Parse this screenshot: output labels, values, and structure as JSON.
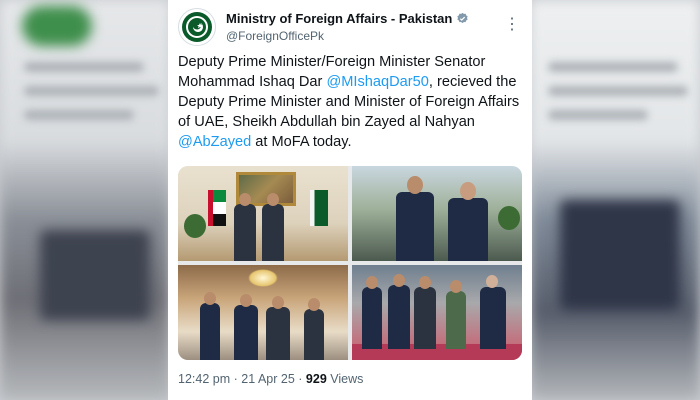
{
  "tweet": {
    "account_name": "Ministry of Foreign Affairs - Pakistan",
    "handle": "@ForeignOfficePk",
    "text_1": "Deputy Prime Minister/Foreign Minister  Senator Mohammad Ishaq Dar ",
    "mention_1": "@MIshaqDar50",
    "text_2": ", recieved the Deputy Prime Minister and Minister of Foreign Affairs of UAE, Sheikh Abdullah bin Zayed al Nahyan ",
    "mention_2": "@AbZayed",
    "text_3": " at MoFA today.",
    "time": "12:42 pm",
    "separator": "·",
    "date": "21 Apr 25",
    "views_count": "929",
    "views_label": "Views"
  },
  "icons": {
    "avatar": "ministry-emblem",
    "verified": "verified-badge-icon",
    "more": "more-options-icon"
  },
  "colors": {
    "link": "#1d9bf0",
    "text": "#0f1419",
    "secondary": "#536471",
    "verified": "#829aab"
  }
}
